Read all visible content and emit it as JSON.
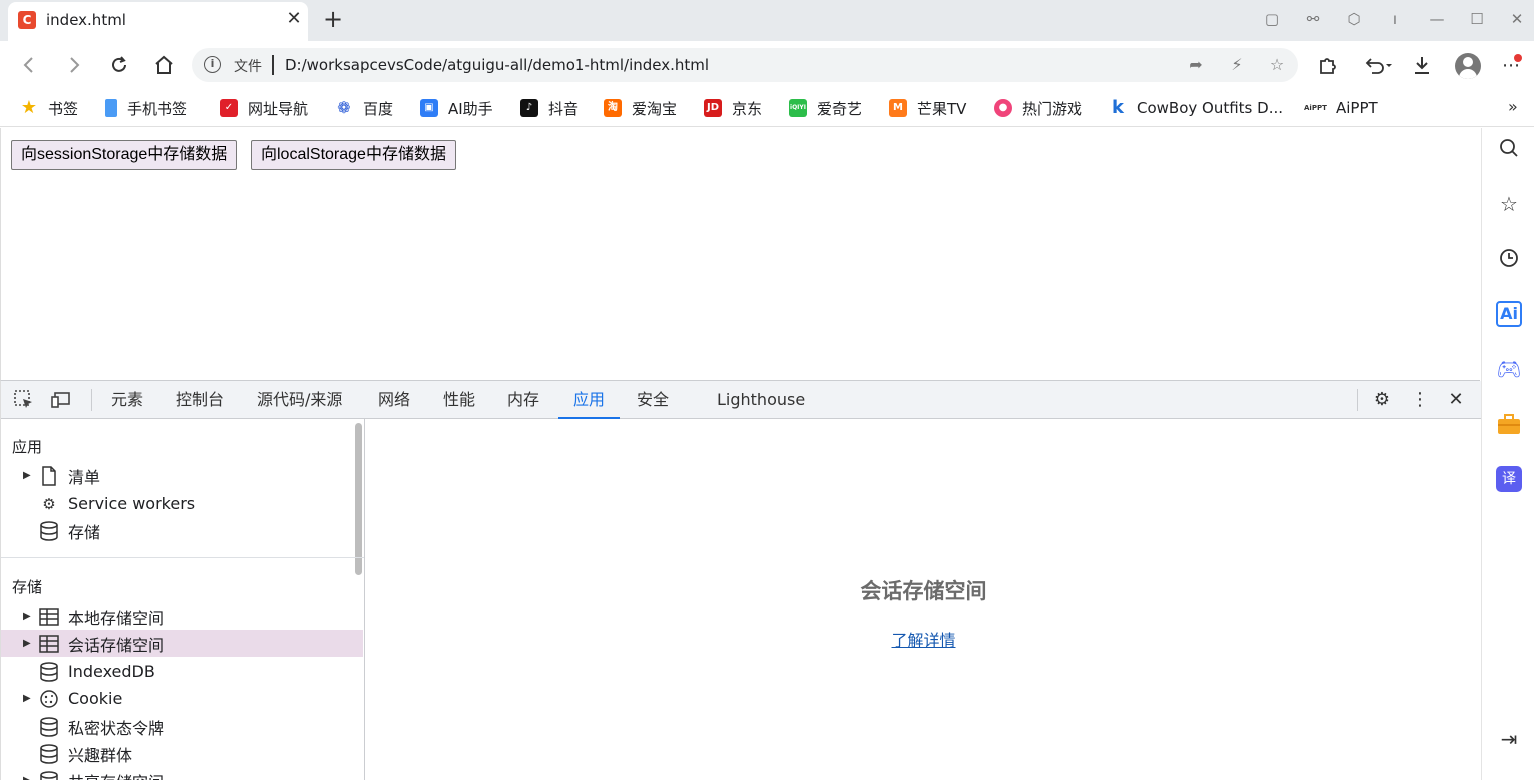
{
  "browser": {
    "tab_title": "index.html",
    "tab_favicon_letter": "C",
    "url_scheme_label": "文件",
    "url": "D:/worksapcevsCode/atguigu-all/demo1-html/index.html"
  },
  "bookmarks": [
    {
      "label": "书签",
      "icon": "star-icon",
      "color": "#f4b400"
    },
    {
      "label": "手机书签",
      "icon": "phone-icon",
      "color": "#4a9bf5"
    },
    {
      "label": "网址导航",
      "icon": "nav-icon",
      "color": "#e0202a"
    },
    {
      "label": "百度",
      "icon": "baidu-paw-icon",
      "color": "#2a5bd7"
    },
    {
      "label": "AI助手",
      "icon": "ai-assistant-icon",
      "color": "#2f7df6"
    },
    {
      "label": "抖音",
      "icon": "douyin-icon",
      "color": "#111111"
    },
    {
      "label": "爱淘宝",
      "icon": "taobao-icon",
      "color": "#ff6a00"
    },
    {
      "label": "京东",
      "icon": "jd-icon",
      "color": "#d71c1c"
    },
    {
      "label": "爱奇艺",
      "icon": "iqiyi-icon",
      "color": "#2cbd4a"
    },
    {
      "label": "芒果TV",
      "icon": "mango-icon",
      "color": "#ff7a1a"
    },
    {
      "label": "热门游戏",
      "icon": "games-icon",
      "color": "#f0447a"
    },
    {
      "label": "CowBoy Outfits D...",
      "icon": "k-icon",
      "color": "#1f6fd6"
    },
    {
      "label": "AiPPT",
      "icon": "aippt-icon",
      "color": "#333333"
    }
  ],
  "page": {
    "button_session": "向sessionStorage中存储数据",
    "button_local": "向localStorage中存储数据"
  },
  "devtools": {
    "tabs": [
      "元素",
      "控制台",
      "源代码/来源",
      "网络",
      "性能",
      "内存",
      "应用",
      "安全",
      "Lighthouse"
    ],
    "active_tab": "应用",
    "sidebar": {
      "app_section_title": "应用",
      "app_items": [
        "清单",
        "Service workers",
        "存储"
      ],
      "storage_section_title": "存储",
      "storage_items": [
        "本地存储空间",
        "会话存储空间",
        "IndexedDB",
        "Cookie",
        "私密状态令牌",
        "兴趣群体",
        "共享存储空间"
      ],
      "selected_item": "会话存储空间"
    },
    "main": {
      "empty_title": "会话存储空间",
      "learn_more": "了解详情"
    }
  }
}
